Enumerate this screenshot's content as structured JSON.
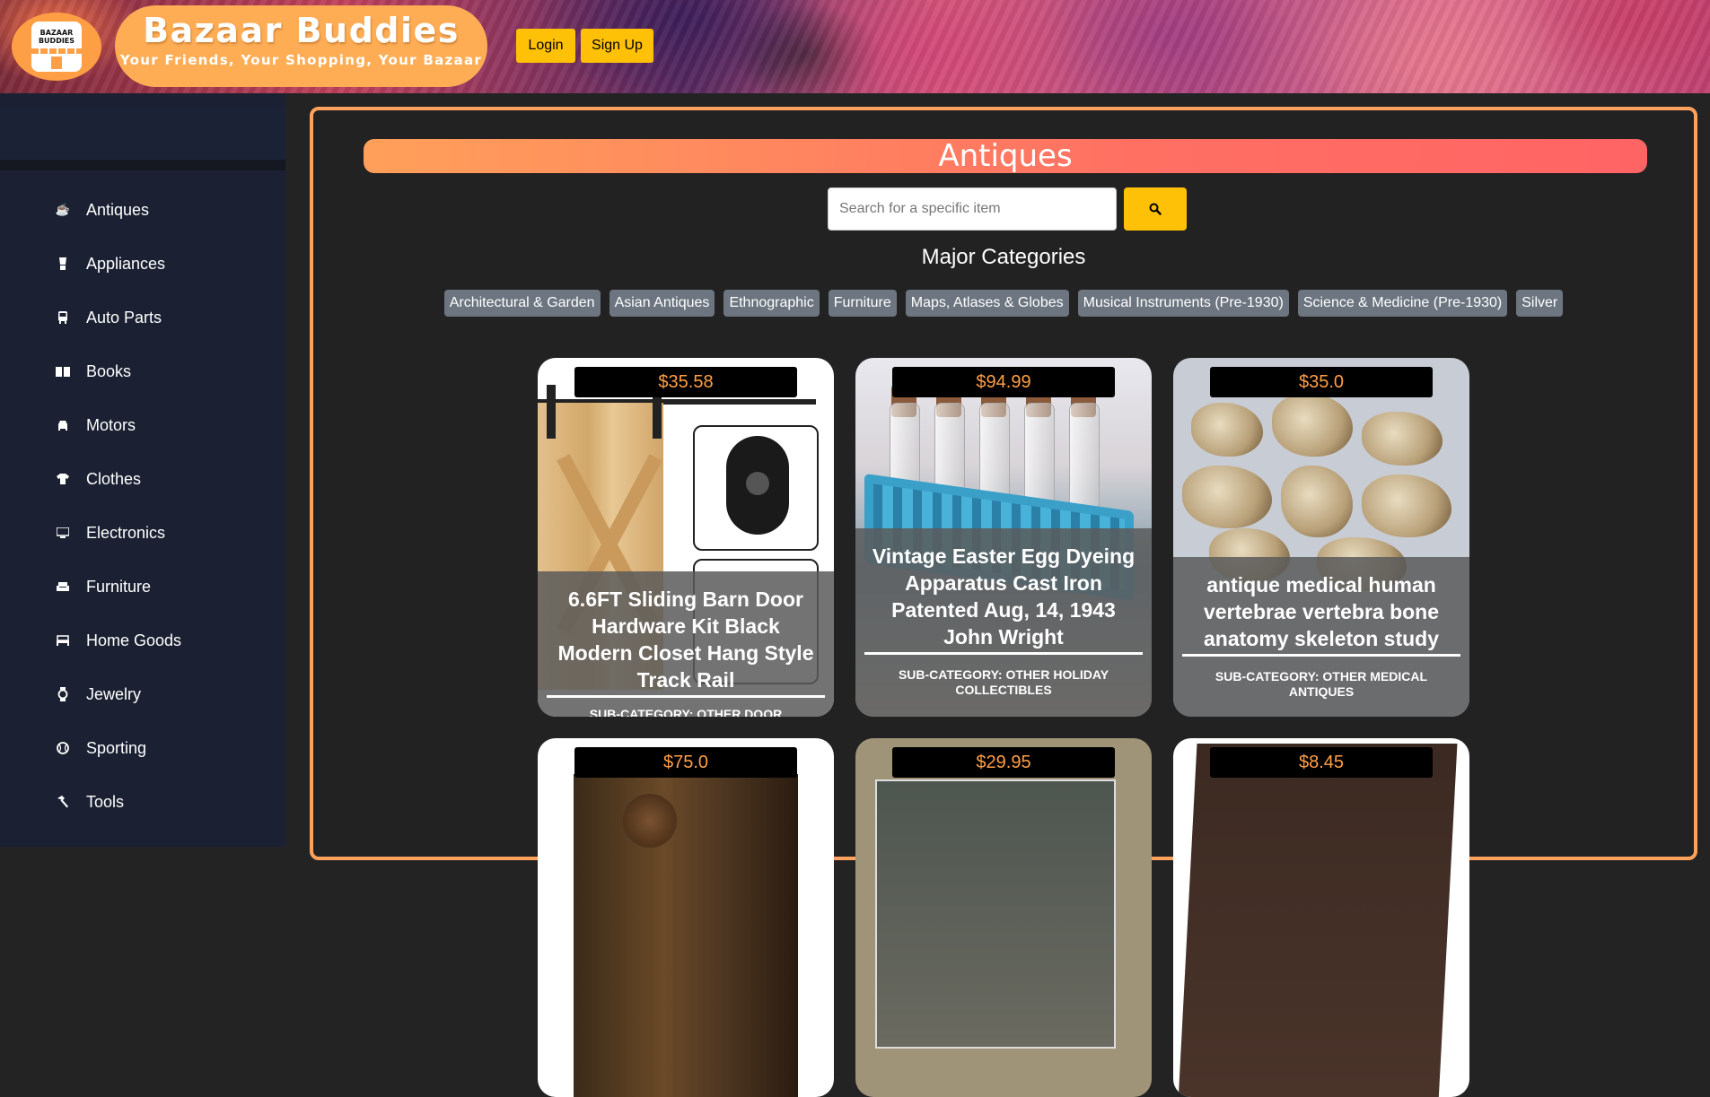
{
  "header": {
    "logo_text": "BAZAAR BUDDIES",
    "brand_title": "Bazaar Buddies",
    "brand_tagline": "Your Friends, Your Shopping, Your Bazaar",
    "login_label": "Login",
    "signup_label": "Sign Up"
  },
  "sidebar": {
    "items": [
      {
        "label": "Antiques",
        "icon": "coffee-cup-icon"
      },
      {
        "label": "Appliances",
        "icon": "blender-icon"
      },
      {
        "label": "Auto Parts",
        "icon": "bus-icon"
      },
      {
        "label": "Books",
        "icon": "book-open-icon"
      },
      {
        "label": "Motors",
        "icon": "car-icon"
      },
      {
        "label": "Clothes",
        "icon": "shirt-icon"
      },
      {
        "label": "Electronics",
        "icon": "monitor-icon"
      },
      {
        "label": "Furniture",
        "icon": "couch-icon"
      },
      {
        "label": "Home Goods",
        "icon": "bed-icon"
      },
      {
        "label": "Jewelry",
        "icon": "watch-icon"
      },
      {
        "label": "Sporting",
        "icon": "baseball-icon"
      },
      {
        "label": "Tools",
        "icon": "hammer-icon"
      }
    ]
  },
  "main": {
    "category_title": "Antiques",
    "search_placeholder": "Search for a specific item",
    "major_categories_title": "Major Categories",
    "chips": [
      "Architectural & Garden",
      "Asian Antiques",
      "Ethnographic",
      "Furniture",
      "Maps, Atlases & Globes",
      "Musical Instruments (Pre-1930)",
      "Science & Medicine (Pre-1930)",
      "Silver"
    ],
    "products": [
      {
        "price": "$35.58",
        "title": "6.6FT Sliding Barn Door Hardware Kit Black Modern Closet Hang Style Track Rail",
        "sub": "SUB-CATEGORY: OTHER DOOR HARDWARE"
      },
      {
        "price": "$94.99",
        "title": "Vintage Easter Egg Dyeing Apparatus Cast Iron Patented Aug, 14, 1943 John Wright",
        "sub": "SUB-CATEGORY: OTHER HOLIDAY COLLECTIBLES"
      },
      {
        "price": "$35.0",
        "title": "antique medical human vertebrae vertebra bone anatomy skeleton study",
        "sub": "SUB-CATEGORY: OTHER MEDICAL ANTIQUES"
      },
      {
        "price": "$75.0"
      },
      {
        "price": "$29.95"
      },
      {
        "price": "$8.45"
      }
    ]
  },
  "colors": {
    "accent_orange": "#ffa35c",
    "button_yellow": "#ffc107",
    "price_text": "#ff9f45",
    "sidebar_bg": "#1b2132",
    "chip_bg": "#6c7580"
  }
}
